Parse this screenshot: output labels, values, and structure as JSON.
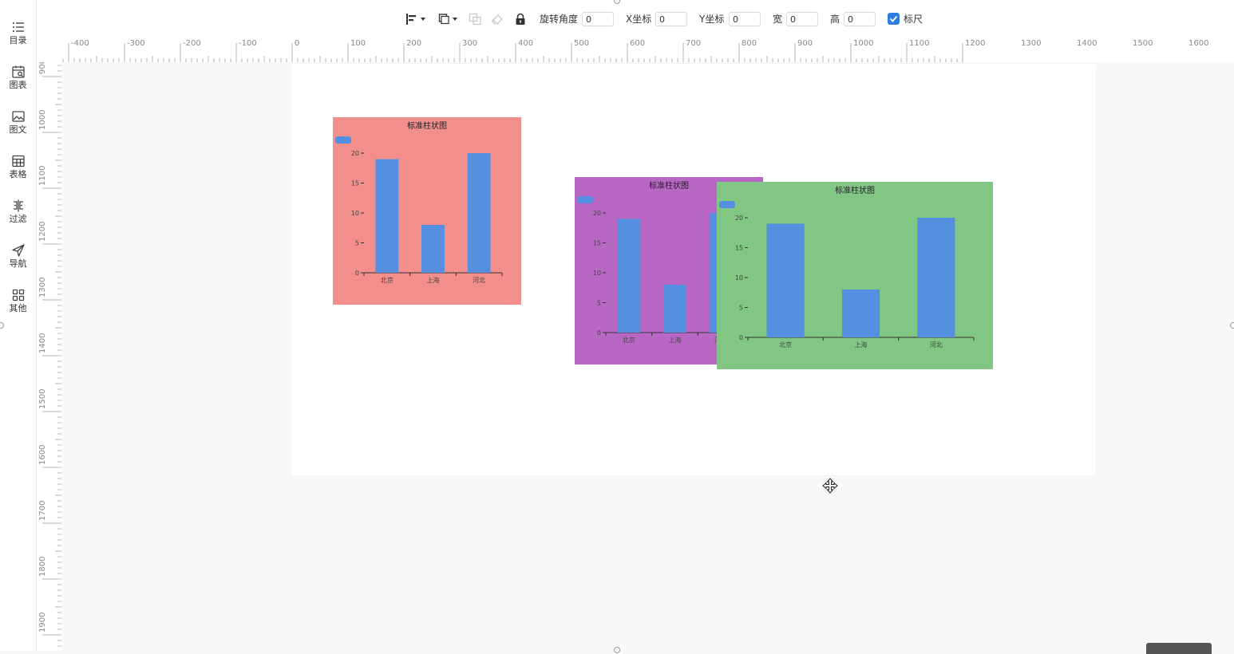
{
  "sidebar": {
    "items": [
      {
        "label": "目录",
        "icon": "list-icon"
      },
      {
        "label": "图表",
        "icon": "chart-calendar-icon"
      },
      {
        "label": "图文",
        "icon": "image-text-icon"
      },
      {
        "label": "表格",
        "icon": "table-icon"
      },
      {
        "label": "过滤",
        "icon": "filter-icon"
      },
      {
        "label": "导航",
        "icon": "navigation-icon"
      },
      {
        "label": "其他",
        "icon": "grid-icon"
      }
    ]
  },
  "toolbar": {
    "rotation_label": "旋转角度",
    "rotation_value": "0",
    "x_label": "X坐标",
    "x_value": "0",
    "y_label": "Y坐标",
    "y_value": "0",
    "width_label": "宽",
    "width_value": "0",
    "height_label": "高",
    "height_value": "0",
    "ruler_label": "标尺",
    "ruler_checked": true,
    "accent_color": "#2f7de1"
  },
  "rulers": {
    "horizontal_ticks": [
      "-400",
      "-300",
      "-200",
      "-100",
      "0",
      "100",
      "200",
      "300",
      "400",
      "500",
      "600",
      "700",
      "800",
      "900",
      "1000",
      "1100",
      "1200",
      "1300",
      "1400",
      "1500",
      "1600"
    ],
    "vertical_ticks": [
      "900",
      "1000",
      "1100",
      "1200",
      "1300",
      "1400",
      "1500",
      "1600",
      "1700",
      "1800",
      "1900"
    ]
  },
  "chart_data": [
    {
      "type": "bar",
      "title": "标准柱状图",
      "background": "#f28e8b",
      "bar_color": "#5590e0",
      "legend": "top-left",
      "categories": [
        "北京",
        "上海",
        "河北"
      ],
      "values": [
        19,
        8,
        20
      ],
      "ylim": [
        0,
        20
      ],
      "yticks": [
        "0",
        "5",
        "10",
        "15",
        "20"
      ]
    },
    {
      "type": "bar",
      "title": "标准柱状图",
      "background": "#b967c5",
      "bar_color": "#5590e0",
      "legend": "top-left",
      "categories": [
        "北京",
        "上海",
        "河北"
      ],
      "values": [
        19,
        8,
        20
      ],
      "ylim": [
        0,
        20
      ],
      "yticks": [
        "0",
        "5",
        "10",
        "15",
        "20"
      ]
    },
    {
      "type": "bar",
      "title": "标准柱状图",
      "background": "#81c682",
      "bar_color": "#5590e0",
      "legend": "top-left",
      "categories": [
        "北京",
        "上海",
        "河北"
      ],
      "values": [
        19,
        8,
        20
      ],
      "ylim": [
        0,
        20
      ],
      "yticks": [
        "0",
        "5",
        "10",
        "15",
        "20"
      ]
    }
  ]
}
